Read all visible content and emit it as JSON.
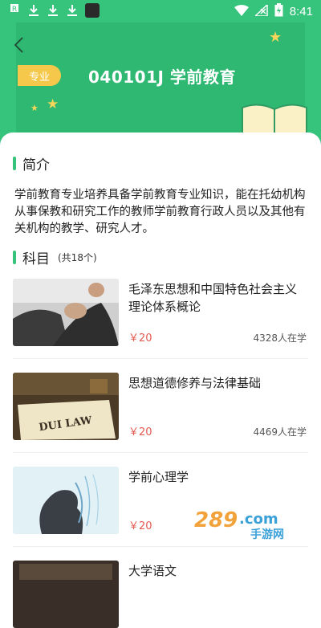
{
  "status_bar": {
    "time": "8:41"
  },
  "header": {
    "tag": "专业",
    "title": "040101J 学前教育"
  },
  "intro": {
    "heading": "简介",
    "text": "学前教育专业培养具备学前教育专业知识，能在托幼机构从事保教和研究工作的教师学前教育行政人员以及其他有关机构的教学、研究人才。"
  },
  "subjects": {
    "heading": "科目",
    "count": "(共18个)",
    "items": [
      {
        "name": "毛泽东思想和中国特色社会主义理论体系概论",
        "price": "￥20",
        "learners": "4328人在学",
        "image": "arm-wrestling-photo"
      },
      {
        "name": "思想道德修养与法律基础",
        "price": "￥20",
        "learners": "4469人在学",
        "image": "dui-law-book-photo"
      },
      {
        "name": "学前心理学",
        "price": "￥20",
        "learners": "",
        "image": "head-profile-photo"
      },
      {
        "name": "大学语文",
        "price": "",
        "learners": "",
        "image": "book-photo"
      }
    ]
  },
  "watermark": {
    "text": "289.com",
    "subtext": "手游网"
  },
  "colors": {
    "primary": "#36c47c",
    "accent": "#f5c84b",
    "price": "#e45a4f"
  }
}
